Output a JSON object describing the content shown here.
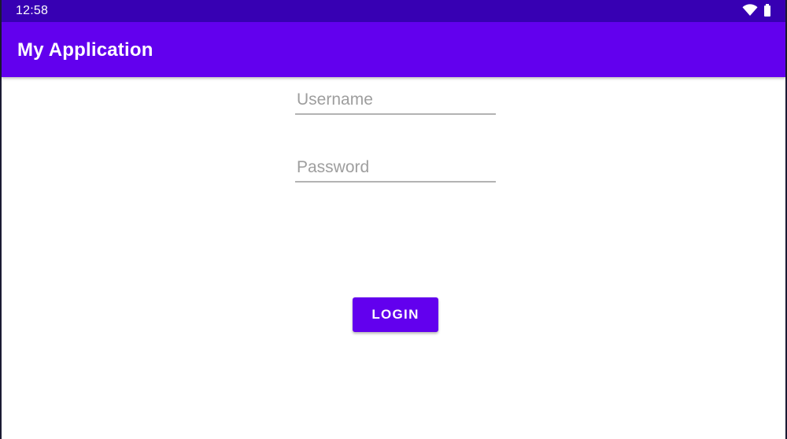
{
  "status_bar": {
    "time": "12:58",
    "icons": [
      "wifi-icon",
      "battery-icon"
    ],
    "background": "#3700b3"
  },
  "app_bar": {
    "title": "My Application",
    "background": "#6200ee"
  },
  "login_form": {
    "username": {
      "placeholder": "Username",
      "value": ""
    },
    "password": {
      "placeholder": "Password",
      "value": ""
    },
    "login_button_label": "LOGIN"
  },
  "colors": {
    "primary": "#6200ee",
    "primary_dark": "#3700b3",
    "hint_text": "#9e9e9e",
    "underline": "#b3b3b3"
  }
}
